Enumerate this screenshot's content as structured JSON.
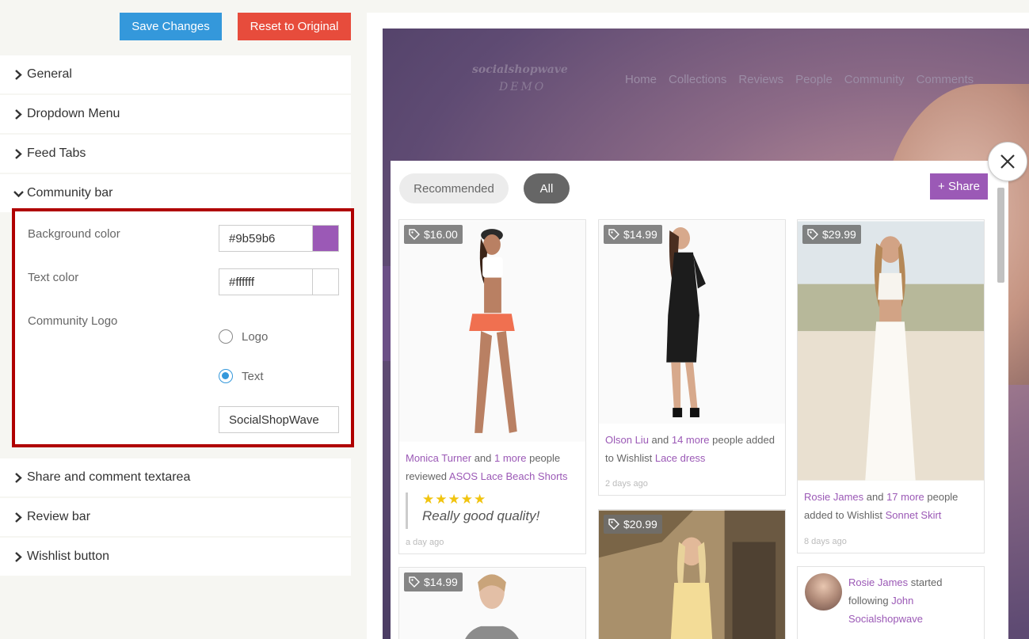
{
  "toolbar": {
    "save_label": "Save Changes",
    "reset_label": "Reset to Original"
  },
  "accordion": {
    "general": "General",
    "dropdown_menu": "Dropdown Menu",
    "feed_tabs": "Feed Tabs",
    "community_bar": "Community bar",
    "share_comment": "Share and comment textarea",
    "review_bar": "Review bar",
    "wishlist_button": "Wishlist button"
  },
  "community_bar": {
    "bg_label": "Background color",
    "bg_value": "#9b59b6",
    "bg_swatch": "#9b59b6",
    "text_label": "Text color",
    "text_value": "#ffffff",
    "text_swatch": "#ffffff",
    "logo_label": "Community Logo",
    "option_logo": "Logo",
    "option_text": "Text",
    "selected_option": "Text",
    "logo_text_value": "SocialShopWave"
  },
  "preview": {
    "logo_main": "socialshopwave",
    "logo_sub": "DEMO",
    "nav": [
      "Home",
      "Collections",
      "Reviews",
      "People",
      "Community",
      "Comments"
    ],
    "tabs": {
      "recommended": "Recommended",
      "all": "All"
    },
    "share_label": "+ Share",
    "cards": {
      "c1": {
        "price": "$16.00",
        "user": "Monica Turner",
        "and": " and ",
        "more": "1 more",
        "rest": " people reviewed ",
        "product": "ASOS Lace Beach Shorts",
        "stars": "★★★★★",
        "quote": "Really good quality!",
        "ago": "a day ago"
      },
      "c2": {
        "price": "$14.99",
        "user": "Olson Liu",
        "and": " and ",
        "more": "14 more",
        "rest": " people added to Wishlist ",
        "product": "Lace dress",
        "ago": "2 days ago"
      },
      "c3": {
        "price": "$29.99",
        "user": "Rosie James",
        "and": " and ",
        "more": "17 more",
        "rest": " people added to Wishlist ",
        "product": "Sonnet Skirt",
        "ago": "8 days ago"
      },
      "c4": {
        "price": "$14.99"
      },
      "c5": {
        "price": "$20.99"
      },
      "c6": {
        "user": "Rosie James",
        "rest": " started following ",
        "target": "John Socialshopwave"
      }
    }
  }
}
